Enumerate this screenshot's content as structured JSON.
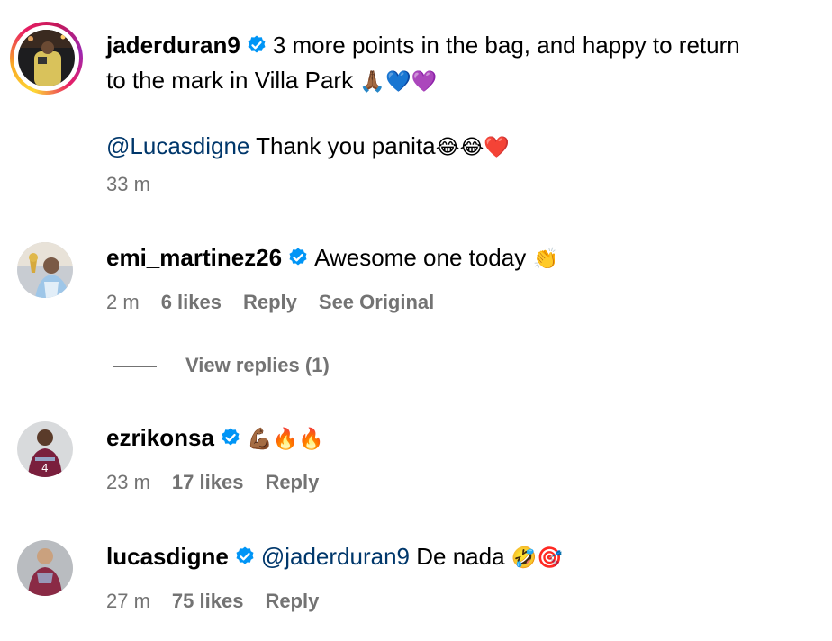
{
  "post": {
    "username": "jaderduran9",
    "caption_line1": "3 more points in the bag, and happy to return",
    "caption_line2": "to the mark in Villa Park",
    "caption_emojis": "🙏🏾💙💜",
    "mention": "@Lucasdigne",
    "mention_text": "Thank you panita",
    "mention_emojis": "😂😂❤️",
    "time": "33 m"
  },
  "comments": [
    {
      "username": "emi_martinez26",
      "text": "Awesome one today",
      "emojis": "👏",
      "time": "2 m",
      "likes": "6 likes",
      "reply_label": "Reply",
      "see_original_label": "See Original"
    },
    {
      "username": "ezrikonsa",
      "text": "",
      "emojis": "💪🏾🔥🔥",
      "time": "23 m",
      "likes": "17 likes",
      "reply_label": "Reply"
    },
    {
      "username": "lucasdigne",
      "mention": "@jaderduran9",
      "text": "De nada",
      "emojis": "🤣🎯",
      "time": "27 m",
      "likes": "75 likes",
      "reply_label": "Reply"
    }
  ],
  "view_replies_label": "View replies (1)",
  "colors": {
    "verified": "#0095f6",
    "mention": "#00376b",
    "meta": "#737373"
  },
  "icons": {
    "verified": "verified-badge-icon"
  }
}
